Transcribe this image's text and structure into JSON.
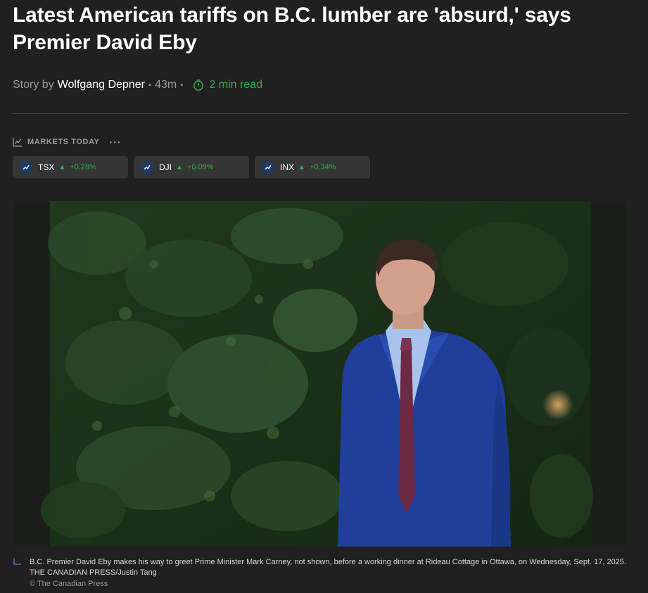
{
  "article": {
    "headline": "Latest American tariffs on B.C. lumber are 'absurd,' says Premier David Eby",
    "byline": {
      "prefix": "Story by",
      "author": "Wolfgang Depner",
      "age": "43m",
      "read_time": "2 min read"
    }
  },
  "markets": {
    "heading": "MARKETS TODAY",
    "more_label": "···",
    "tickers": [
      {
        "symbol": "TSX",
        "change": "+0.28%"
      },
      {
        "symbol": "DJI",
        "change": "+0.09%"
      },
      {
        "symbol": "INX",
        "change": "+0.34%"
      }
    ]
  },
  "image": {
    "caption": "B.C. Premier David Eby makes his way to greet Prime Minister Mark Carney, not shown, before a working dinner at Rideau Cottage in Ottawa, on Wednesday, Sept. 17, 2025. THE CANADIAN PRESS/Justin Tang",
    "credit": "© The Canadian Press"
  },
  "colors": {
    "background": "#202020",
    "accent_green": "#2fae4e",
    "ticker_bg": "#353535"
  },
  "icons": [
    "timer-icon",
    "chart-icon",
    "more-icon",
    "ticker-badge-icon",
    "up-arrow-icon",
    "caption-corner-icon"
  ]
}
